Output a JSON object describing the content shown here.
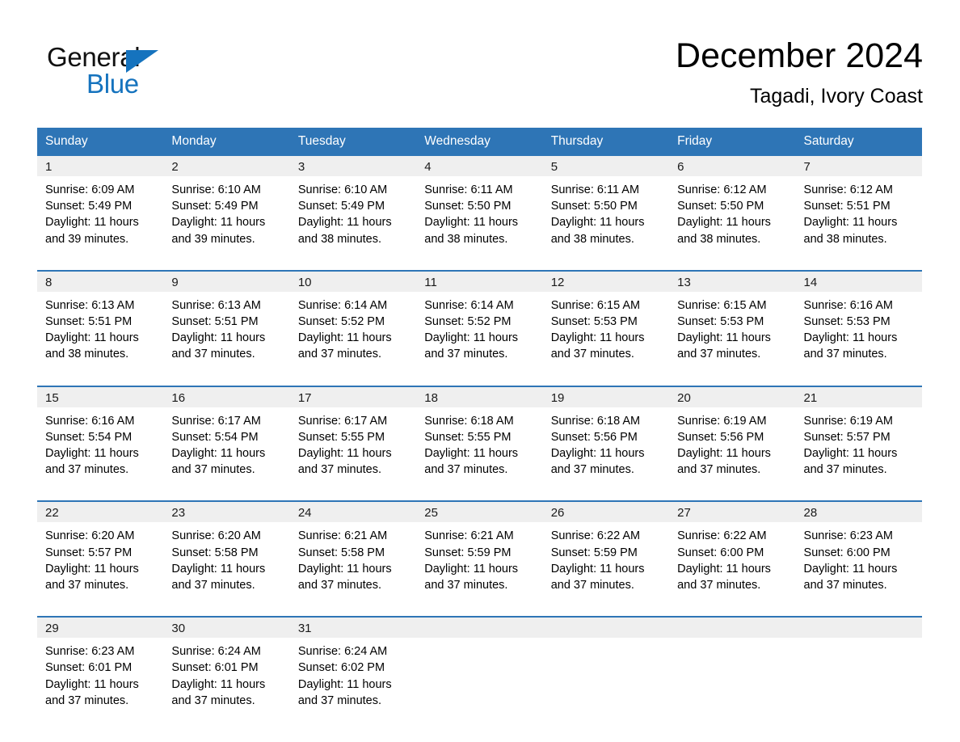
{
  "brand": {
    "logo_line1": "General",
    "logo_line2": "Blue",
    "logo_accent_color": "#1573BE",
    "triangle_icon": "triangle-icon"
  },
  "header": {
    "title": "December 2024",
    "location": "Tagadi, Ivory Coast"
  },
  "theme": {
    "header_blue": "#2E75B6",
    "row_divider_blue": "#2E75B6",
    "date_band_gray": "#EFEFEF",
    "text_black": "#000000"
  },
  "weekdays": [
    "Sunday",
    "Monday",
    "Tuesday",
    "Wednesday",
    "Thursday",
    "Friday",
    "Saturday"
  ],
  "weeks": [
    [
      {
        "day": "1",
        "sunrise": "Sunrise: 6:09 AM",
        "sunset": "Sunset: 5:49 PM",
        "daylight1": "Daylight: 11 hours",
        "daylight2": "and 39 minutes."
      },
      {
        "day": "2",
        "sunrise": "Sunrise: 6:10 AM",
        "sunset": "Sunset: 5:49 PM",
        "daylight1": "Daylight: 11 hours",
        "daylight2": "and 39 minutes."
      },
      {
        "day": "3",
        "sunrise": "Sunrise: 6:10 AM",
        "sunset": "Sunset: 5:49 PM",
        "daylight1": "Daylight: 11 hours",
        "daylight2": "and 38 minutes."
      },
      {
        "day": "4",
        "sunrise": "Sunrise: 6:11 AM",
        "sunset": "Sunset: 5:50 PM",
        "daylight1": "Daylight: 11 hours",
        "daylight2": "and 38 minutes."
      },
      {
        "day": "5",
        "sunrise": "Sunrise: 6:11 AM",
        "sunset": "Sunset: 5:50 PM",
        "daylight1": "Daylight: 11 hours",
        "daylight2": "and 38 minutes."
      },
      {
        "day": "6",
        "sunrise": "Sunrise: 6:12 AM",
        "sunset": "Sunset: 5:50 PM",
        "daylight1": "Daylight: 11 hours",
        "daylight2": "and 38 minutes."
      },
      {
        "day": "7",
        "sunrise": "Sunrise: 6:12 AM",
        "sunset": "Sunset: 5:51 PM",
        "daylight1": "Daylight: 11 hours",
        "daylight2": "and 38 minutes."
      }
    ],
    [
      {
        "day": "8",
        "sunrise": "Sunrise: 6:13 AM",
        "sunset": "Sunset: 5:51 PM",
        "daylight1": "Daylight: 11 hours",
        "daylight2": "and 38 minutes."
      },
      {
        "day": "9",
        "sunrise": "Sunrise: 6:13 AM",
        "sunset": "Sunset: 5:51 PM",
        "daylight1": "Daylight: 11 hours",
        "daylight2": "and 37 minutes."
      },
      {
        "day": "10",
        "sunrise": "Sunrise: 6:14 AM",
        "sunset": "Sunset: 5:52 PM",
        "daylight1": "Daylight: 11 hours",
        "daylight2": "and 37 minutes."
      },
      {
        "day": "11",
        "sunrise": "Sunrise: 6:14 AM",
        "sunset": "Sunset: 5:52 PM",
        "daylight1": "Daylight: 11 hours",
        "daylight2": "and 37 minutes."
      },
      {
        "day": "12",
        "sunrise": "Sunrise: 6:15 AM",
        "sunset": "Sunset: 5:53 PM",
        "daylight1": "Daylight: 11 hours",
        "daylight2": "and 37 minutes."
      },
      {
        "day": "13",
        "sunrise": "Sunrise: 6:15 AM",
        "sunset": "Sunset: 5:53 PM",
        "daylight1": "Daylight: 11 hours",
        "daylight2": "and 37 minutes."
      },
      {
        "day": "14",
        "sunrise": "Sunrise: 6:16 AM",
        "sunset": "Sunset: 5:53 PM",
        "daylight1": "Daylight: 11 hours",
        "daylight2": "and 37 minutes."
      }
    ],
    [
      {
        "day": "15",
        "sunrise": "Sunrise: 6:16 AM",
        "sunset": "Sunset: 5:54 PM",
        "daylight1": "Daylight: 11 hours",
        "daylight2": "and 37 minutes."
      },
      {
        "day": "16",
        "sunrise": "Sunrise: 6:17 AM",
        "sunset": "Sunset: 5:54 PM",
        "daylight1": "Daylight: 11 hours",
        "daylight2": "and 37 minutes."
      },
      {
        "day": "17",
        "sunrise": "Sunrise: 6:17 AM",
        "sunset": "Sunset: 5:55 PM",
        "daylight1": "Daylight: 11 hours",
        "daylight2": "and 37 minutes."
      },
      {
        "day": "18",
        "sunrise": "Sunrise: 6:18 AM",
        "sunset": "Sunset: 5:55 PM",
        "daylight1": "Daylight: 11 hours",
        "daylight2": "and 37 minutes."
      },
      {
        "day": "19",
        "sunrise": "Sunrise: 6:18 AM",
        "sunset": "Sunset: 5:56 PM",
        "daylight1": "Daylight: 11 hours",
        "daylight2": "and 37 minutes."
      },
      {
        "day": "20",
        "sunrise": "Sunrise: 6:19 AM",
        "sunset": "Sunset: 5:56 PM",
        "daylight1": "Daylight: 11 hours",
        "daylight2": "and 37 minutes."
      },
      {
        "day": "21",
        "sunrise": "Sunrise: 6:19 AM",
        "sunset": "Sunset: 5:57 PM",
        "daylight1": "Daylight: 11 hours",
        "daylight2": "and 37 minutes."
      }
    ],
    [
      {
        "day": "22",
        "sunrise": "Sunrise: 6:20 AM",
        "sunset": "Sunset: 5:57 PM",
        "daylight1": "Daylight: 11 hours",
        "daylight2": "and 37 minutes."
      },
      {
        "day": "23",
        "sunrise": "Sunrise: 6:20 AM",
        "sunset": "Sunset: 5:58 PM",
        "daylight1": "Daylight: 11 hours",
        "daylight2": "and 37 minutes."
      },
      {
        "day": "24",
        "sunrise": "Sunrise: 6:21 AM",
        "sunset": "Sunset: 5:58 PM",
        "daylight1": "Daylight: 11 hours",
        "daylight2": "and 37 minutes."
      },
      {
        "day": "25",
        "sunrise": "Sunrise: 6:21 AM",
        "sunset": "Sunset: 5:59 PM",
        "daylight1": "Daylight: 11 hours",
        "daylight2": "and 37 minutes."
      },
      {
        "day": "26",
        "sunrise": "Sunrise: 6:22 AM",
        "sunset": "Sunset: 5:59 PM",
        "daylight1": "Daylight: 11 hours",
        "daylight2": "and 37 minutes."
      },
      {
        "day": "27",
        "sunrise": "Sunrise: 6:22 AM",
        "sunset": "Sunset: 6:00 PM",
        "daylight1": "Daylight: 11 hours",
        "daylight2": "and 37 minutes."
      },
      {
        "day": "28",
        "sunrise": "Sunrise: 6:23 AM",
        "sunset": "Sunset: 6:00 PM",
        "daylight1": "Daylight: 11 hours",
        "daylight2": "and 37 minutes."
      }
    ],
    [
      {
        "day": "29",
        "sunrise": "Sunrise: 6:23 AM",
        "sunset": "Sunset: 6:01 PM",
        "daylight1": "Daylight: 11 hours",
        "daylight2": "and 37 minutes."
      },
      {
        "day": "30",
        "sunrise": "Sunrise: 6:24 AM",
        "sunset": "Sunset: 6:01 PM",
        "daylight1": "Daylight: 11 hours",
        "daylight2": "and 37 minutes."
      },
      {
        "day": "31",
        "sunrise": "Sunrise: 6:24 AM",
        "sunset": "Sunset: 6:02 PM",
        "daylight1": "Daylight: 11 hours",
        "daylight2": "and 37 minutes."
      },
      {
        "day": "",
        "sunrise": "",
        "sunset": "",
        "daylight1": "",
        "daylight2": ""
      },
      {
        "day": "",
        "sunrise": "",
        "sunset": "",
        "daylight1": "",
        "daylight2": ""
      },
      {
        "day": "",
        "sunrise": "",
        "sunset": "",
        "daylight1": "",
        "daylight2": ""
      },
      {
        "day": "",
        "sunrise": "",
        "sunset": "",
        "daylight1": "",
        "daylight2": ""
      }
    ]
  ]
}
